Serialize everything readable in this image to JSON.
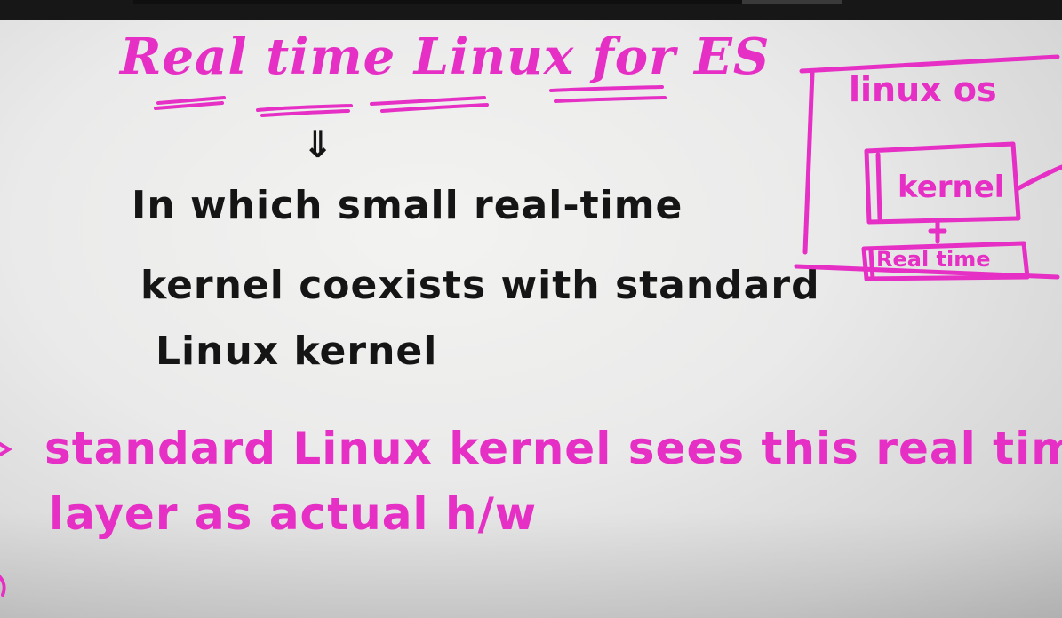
{
  "player": {
    "progress_fraction": 0.86
  },
  "whiteboard": {
    "title": "Real time Linux for ES",
    "arrow_glyph": "⇓",
    "definition_lines": [
      "In which small real-time",
      "kernel coexists with standard",
      "Linux kernel"
    ],
    "bullet_lines": [
      "standard Linux kernel sees this real time",
      "layer as actual h/w"
    ],
    "diagram": {
      "outer_label": "linux os",
      "kernel_label": "kernel",
      "realtime_label": "Real time"
    }
  },
  "colors": {
    "marker_pink": "#e62fc4",
    "marker_black": "#151515",
    "board": "#ececea"
  }
}
